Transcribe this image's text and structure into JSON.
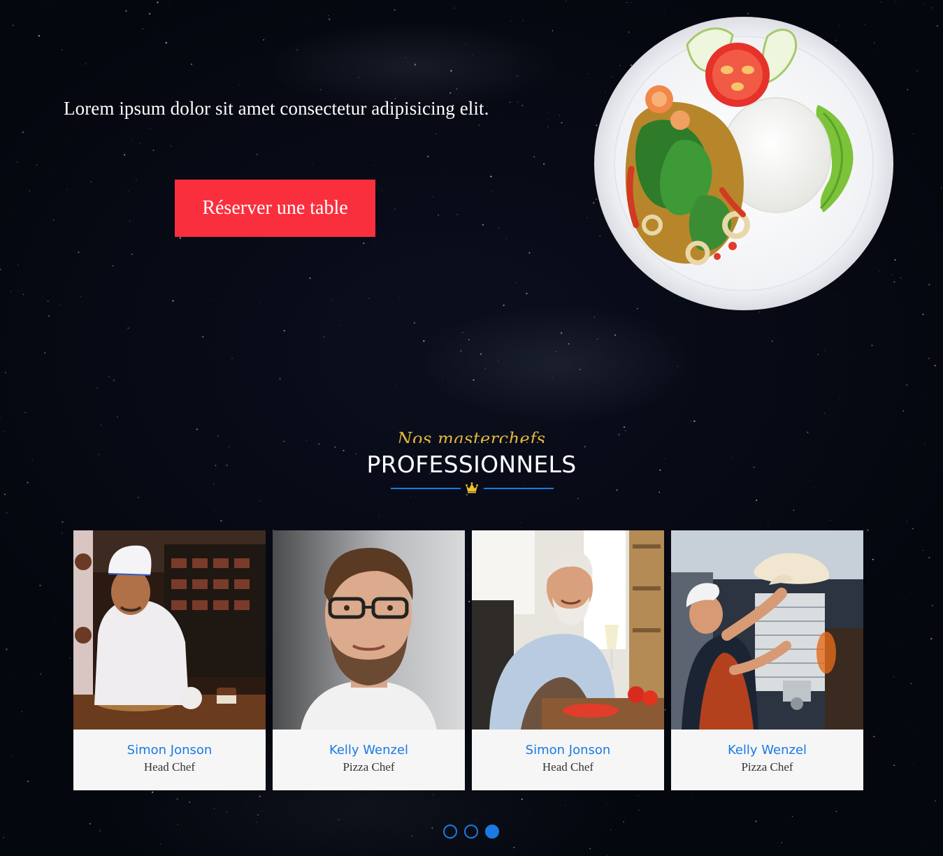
{
  "hero": {
    "text": "Lorem ipsum dolor sit amet consectetur adipisicing elit.",
    "reserve_button": "Réserver une table"
  },
  "team_section": {
    "subtitle": "Nos masterchefs",
    "title": "PROFESSIONNELS"
  },
  "chefs": [
    {
      "name": "Simon Jonson",
      "role": "Head Chef",
      "photo": "chef-cooking-photo"
    },
    {
      "name": "Kelly Wenzel",
      "role": "Pizza Chef",
      "photo": "man-with-glasses-portrait-photo"
    },
    {
      "name": "Simon Jonson",
      "role": "Head Chef",
      "photo": "senior-chef-kitchen-photo"
    },
    {
      "name": "Kelly Wenzel",
      "role": "Pizza Chef",
      "photo": "pizza-chef-tossing-dough-photo"
    }
  ],
  "carousel": {
    "total_pages": 3,
    "active_page": 3
  },
  "colors": {
    "accent_blue": "#1a7ae4",
    "button_red": "#fa2f3e",
    "script_gold": "#e5b83a",
    "background": "#05070f"
  }
}
